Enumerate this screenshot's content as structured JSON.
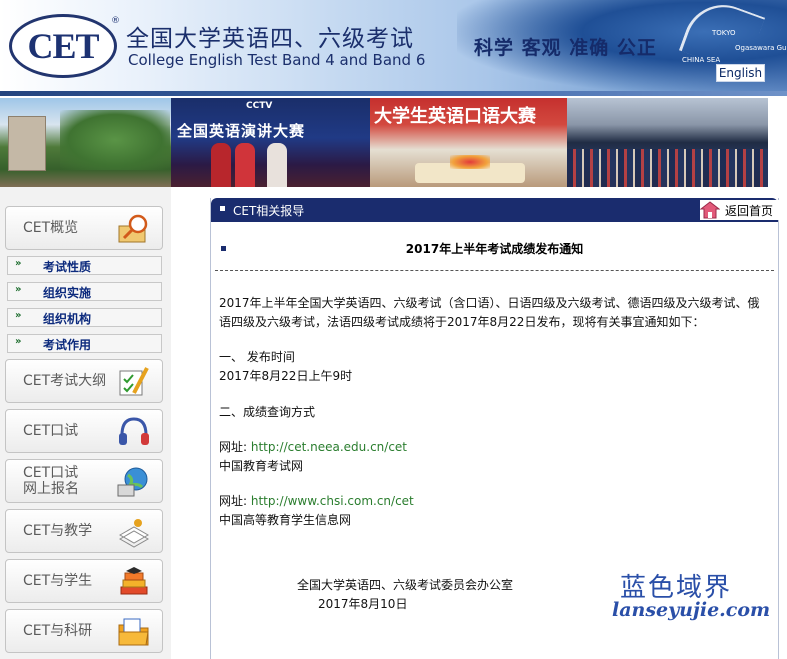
{
  "header": {
    "logo_text": "CET",
    "registered": "®",
    "title_cn": "全国大学英语四、六级考试",
    "title_en": "College English Test Band 4 and Band 6",
    "slogan": "科学  客观  准确  公正",
    "map_labels": [
      "TOKYO",
      "CHINA SEA",
      "Ogasawara Gunto"
    ],
    "english_button": "English"
  },
  "banner": {
    "photo2_logo": "CCTV",
    "photo2_title": "全国英语演讲大赛",
    "photo3_title": "大学生英语口语大赛"
  },
  "sidebar": {
    "items": [
      {
        "label": "CET概览",
        "icon": "magnifier-document-icon"
      },
      {
        "label": "CET考试大纲",
        "icon": "checklist-pencil-icon"
      },
      {
        "label": "CET口试",
        "icon": "headset-icon"
      },
      {
        "label": "CET口试\n网上报名",
        "icon": "globe-computer-icon"
      },
      {
        "label": "CET与教学",
        "icon": "books-icon"
      },
      {
        "label": "CET与学生",
        "icon": "book-stack-icon"
      },
      {
        "label": "CET与科研",
        "icon": "folder-icon"
      }
    ],
    "subitems": [
      "考试性质",
      "组织实施",
      "组织机构",
      "考试作用"
    ]
  },
  "content": {
    "header_title": "CET相关报导",
    "home_link": "返回首页",
    "notice_title": "2017年上半年考试成绩发布通知",
    "para1_line1": "2017年上半年全国大学英语四、六级考试（含口语）、日语四级及六级考试、德语四级及六级考试、俄",
    "para1_line2": "语四级及六级考试，法语四级考试成绩将于2017年8月22日发布，现将有关事宜通知如下：",
    "section1_title": "一、  发布时间",
    "section1_text": "2017年8月22日上午9时",
    "section2_title": "二、成绩查询方式",
    "site1_prefix": "网址: ",
    "site1_url": "http://cet.neea.edu.cn/cet",
    "site1_name": "中国教育考试网",
    "site2_prefix": "网址: ",
    "site2_url": "http://www.chsi.com.cn/cet",
    "site2_name": "中国高等教育学生信息网",
    "sign_org": "全国大学英语四、六级考试委员会办公室",
    "sign_date": "2017年8月10日"
  },
  "watermark": {
    "cn": "蓝色域界",
    "en": "lanseyujie.com"
  },
  "colors": {
    "navy": "#1a2c6e",
    "link_green": "#2a7d2e",
    "sub_blue": "#0c2a7d",
    "watermark_blue": "#2a4fa8"
  }
}
